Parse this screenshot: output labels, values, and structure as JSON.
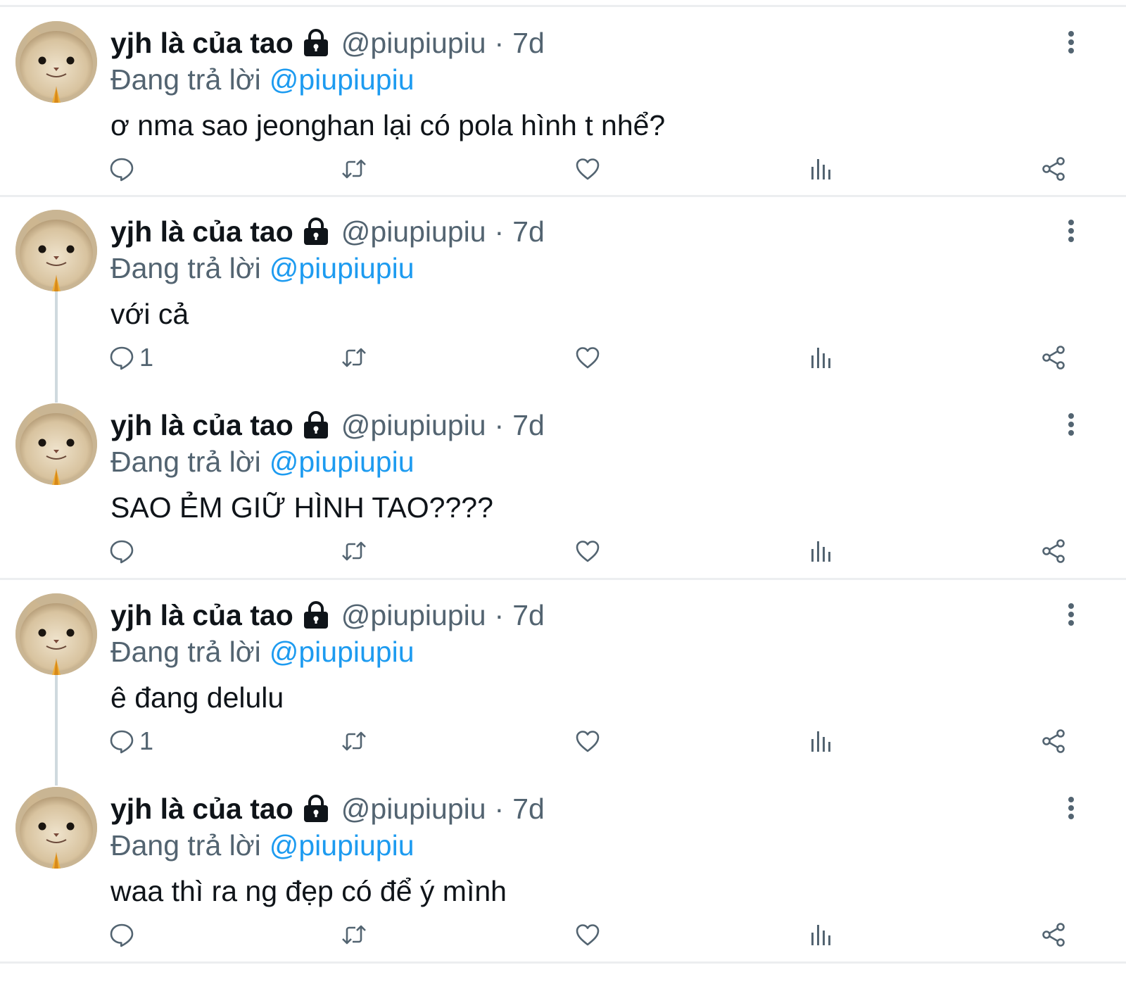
{
  "colors": {
    "link": "#1d9bf0",
    "muted": "#536471",
    "text": "#0f1419",
    "divider": "#eceef0"
  },
  "tweets": [
    {
      "name": "yjh là của tao",
      "handle": "@piupiupiu",
      "time": "7d",
      "dot": "·",
      "replying": "Đang trả lời",
      "mention": "@piupiupiu",
      "text": "ơ nma sao jeonghan lại có pola hình t nhể?",
      "reply_count": ""
    },
    {
      "name": "yjh là của tao",
      "handle": "@piupiupiu",
      "time": "7d",
      "dot": "·",
      "replying": "Đang trả lời",
      "mention": "@piupiupiu",
      "text": "với cả",
      "reply_count": "1"
    },
    {
      "name": "yjh là của tao",
      "handle": "@piupiupiu",
      "time": "7d",
      "dot": "·",
      "replying": "Đang trả lời",
      "mention": "@piupiupiu",
      "text": "SAO ẺM GIỮ HÌNH TAO????",
      "reply_count": ""
    },
    {
      "name": "yjh là của tao",
      "handle": "@piupiupiu",
      "time": "7d",
      "dot": "·",
      "replying": "Đang trả lời",
      "mention": "@piupiupiu",
      "text": "ê đang delulu",
      "reply_count": "1"
    },
    {
      "name": "yjh là của tao",
      "handle": "@piupiupiu",
      "time": "7d",
      "dot": "·",
      "replying": "Đang trả lời",
      "mention": "@piupiupiu",
      "text": "waa thì ra ng đẹp có để ý mình",
      "reply_count": ""
    }
  ],
  "icons": {
    "avatar": "cat-avatar-icon",
    "lock": "lock-icon",
    "more": "more-vertical-icon",
    "reply": "reply-icon",
    "retweet": "retweet-icon",
    "like": "heart-icon",
    "views": "views-icon",
    "share": "share-icon"
  }
}
